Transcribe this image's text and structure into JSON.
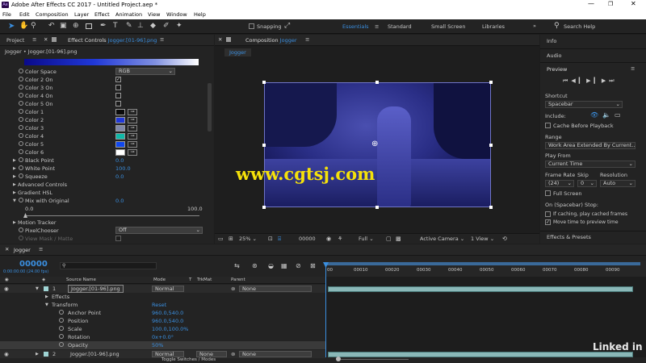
{
  "app": {
    "title": "Adobe After Effects CC 2017 - Untitled Project.aep *"
  },
  "menu": [
    "File",
    "Edit",
    "Composition",
    "Layer",
    "Effect",
    "Animation",
    "View",
    "Window",
    "Help"
  ],
  "toolbar": {
    "snapping_label": "Snapping",
    "workspaces": [
      "Essentials",
      "Standard",
      "Small Screen",
      "Libraries"
    ],
    "search_placeholder": "Search Help"
  },
  "project_panel": {
    "tab_project": "Project",
    "tab_effect_controls": "Effect Controls",
    "effect_controls_layer": "Jogger.[01-96].png",
    "breadcrumb": "Jogger • Jogger.[01-96].png"
  },
  "effect_controls": {
    "color_space_label": "Color Space",
    "color_space_value": "RGB",
    "color_on": [
      {
        "label": "Color 2 On",
        "checked": true
      },
      {
        "label": "Color 3 On",
        "checked": false
      },
      {
        "label": "Color 4 On",
        "checked": false
      },
      {
        "label": "Color 5 On",
        "checked": false
      }
    ],
    "colors": [
      {
        "label": "Color 1",
        "hex": "#0a0a0a"
      },
      {
        "label": "Color 2",
        "hex": "#2038d8"
      },
      {
        "label": "Color 3",
        "hex": "#8088a8"
      },
      {
        "label": "Color 4",
        "hex": "#10b8a8"
      },
      {
        "label": "Color 5",
        "hex": "#1048f0"
      },
      {
        "label": "Color 6",
        "hex": "#ffffff"
      }
    ],
    "black_point": {
      "label": "Black Point",
      "value": "0.0"
    },
    "white_point": {
      "label": "White Point",
      "value": "100.0"
    },
    "squeeze": {
      "label": "Squeeze",
      "value": "0.0"
    },
    "advanced_controls": "Advanced Controls",
    "gradient_hsl": "Gradient HSL",
    "mix_with_original": {
      "label": "Mix with Original",
      "value": "0.0"
    },
    "slider_min": "0.0",
    "slider_max": "100.0",
    "slider_level": 0.0,
    "motion_tracker": "Motion Tracker",
    "pixel_chooser": {
      "label": "PixelChooser",
      "value": "Off"
    },
    "view_mask": "View Mask / Matte"
  },
  "composition": {
    "tab_label": "Composition",
    "comp_name": "Jogger",
    "sub_tab": "Jogger",
    "watermark": "www.cgtsj.com",
    "zoom": "25%",
    "timecode": "00000",
    "resolution": "Full",
    "camera": "Active Camera",
    "views": "1 View"
  },
  "right_panel": {
    "info": "Info",
    "audio": "Audio",
    "preview": "Preview",
    "shortcut_label": "Shortcut",
    "shortcut_value": "Spacebar",
    "include_label": "Include:",
    "cache_before_playback": "Cache Before Playback",
    "range_label": "Range",
    "range_value": "Work Area Extended By Current...",
    "play_from_label": "Play From",
    "play_from_value": "Current Time",
    "frame_rate_label": "Frame Rate",
    "skip_label": "Skip",
    "resolution_label": "Resolution",
    "frame_rate_value": "(24)",
    "skip_value": "0",
    "resolution_value": "Auto",
    "full_screen": "Full Screen",
    "on_stop_label": "On (Spacebar) Stop:",
    "if_caching": "If caching, play cached frames",
    "move_time": "Move time to preview time",
    "effects_presets": "Effects & Presets"
  },
  "timeline": {
    "tab": "Jogger",
    "current_time": "00000",
    "current_time_sub": "0:00:00:00 (24.00 fps)",
    "columns": {
      "source_name": "Source Name",
      "mode": "Mode",
      "t": "T",
      "trkmat": "TrkMat",
      "parent": "Parent"
    },
    "layers": [
      {
        "num": "1",
        "name": "Jogger.[01-96].png",
        "mode": "Normal",
        "trkmat": "",
        "parent": "None"
      },
      {
        "num": "2",
        "name": "Jogger.[01-96].png",
        "mode": "Normal",
        "trkmat": "None",
        "parent": "None"
      }
    ],
    "effects_label": "Effects",
    "transform_label": "Transform",
    "transform_reset": "Reset",
    "props": [
      {
        "label": "Anchor Point",
        "value": "960.0,540.0"
      },
      {
        "label": "Position",
        "value": "960.0,540.0"
      },
      {
        "label": "Scale",
        "value": "100.0,100.0%"
      },
      {
        "label": "Rotation",
        "value": "0x+0.0°"
      },
      {
        "label": "Opacity",
        "value": "50%"
      }
    ],
    "ruler": [
      "00",
      "00010",
      "00020",
      "00030",
      "00040",
      "00050",
      "00060",
      "00070",
      "00080",
      "00090"
    ],
    "toggle_label": "Toggle Switches / Modes",
    "watermark": "Linked in"
  }
}
